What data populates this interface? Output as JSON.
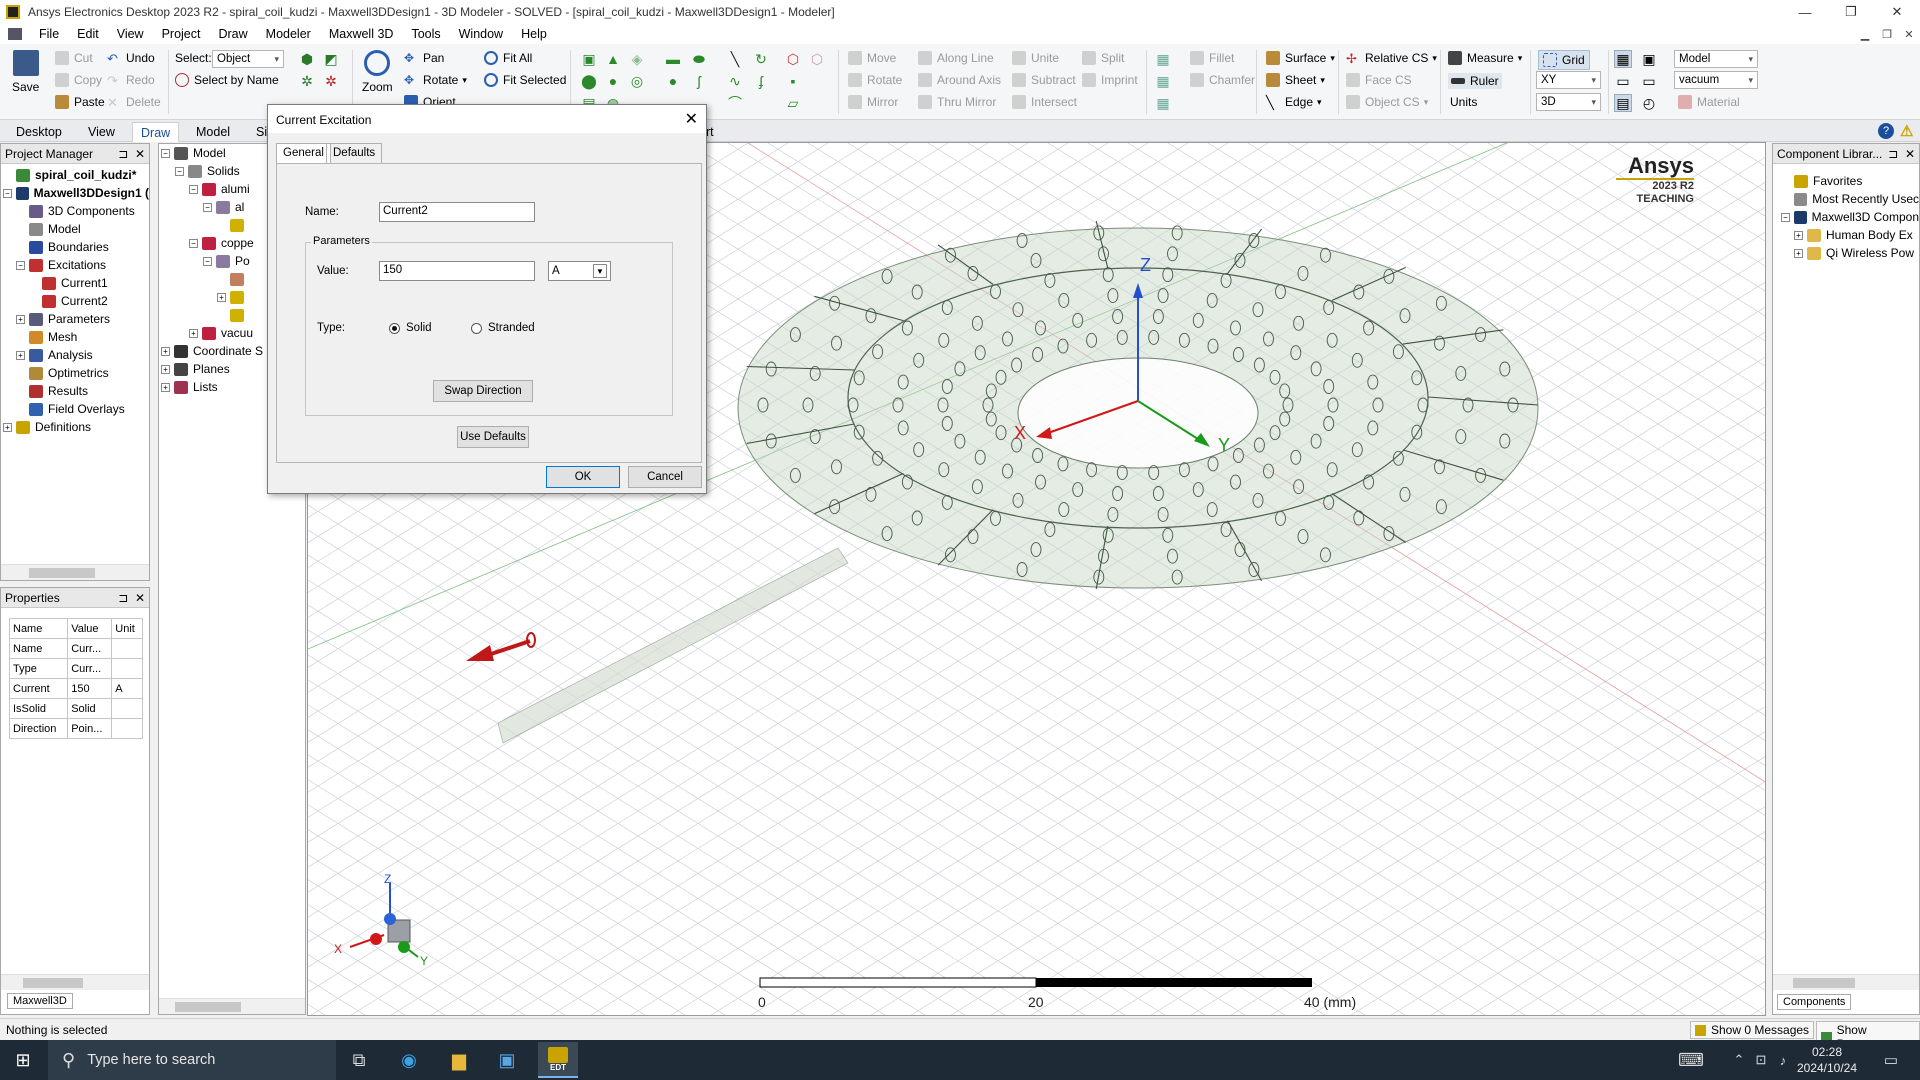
{
  "window": {
    "title": "Ansys Electronics Desktop 2023 R2 - spiral_coil_kudzi - Maxwell3DDesign1 - 3D Modeler - SOLVED - [spiral_coil_kudzi - Maxwell3DDesign1 - Modeler]",
    "minimize": "—",
    "restore": "❐",
    "close": "✕"
  },
  "menu": [
    "File",
    "Edit",
    "View",
    "Project",
    "Draw",
    "Modeler",
    "Maxwell 3D",
    "Tools",
    "Window",
    "Help"
  ],
  "ribbon": {
    "save": "Save",
    "cut": "Cut",
    "copy": "Copy",
    "paste": "Paste",
    "undo": "Undo",
    "redo": "Redo",
    "delete": "Delete",
    "select_label": "Select:",
    "select_value": "Object",
    "select_by_name": "Select by Name",
    "zoom": "Zoom",
    "pan": "Pan",
    "rotate": "Rotate",
    "orient": "Orient",
    "fit_all": "Fit All",
    "fit_selected": "Fit Selected",
    "move": "Move",
    "rotate2": "Rotate",
    "mirror": "Mirror",
    "along_line": "Along Line",
    "around_axis": "Around Axis",
    "thru_mirror": "Thru Mirror",
    "unite": "Unite",
    "subtract": "Subtract",
    "intersect": "Intersect",
    "split": "Split",
    "imprint": "Imprint",
    "fillet": "Fillet",
    "chamfer": "Chamfer",
    "surface": "Surface",
    "sheet": "Sheet",
    "edge": "Edge",
    "relative_cs": "Relative CS",
    "face_cs": "Face CS",
    "object_cs": "Object CS",
    "measure": "Measure",
    "ruler": "Ruler",
    "units": "Units",
    "grid": "Grid",
    "plane": "XY",
    "dim": "3D",
    "model": "Model",
    "material_value": "vacuum",
    "material": "Material"
  },
  "ribbon_tabs": [
    "Desktop",
    "View",
    "Draw",
    "Model",
    "Si"
  ],
  "ribbon_tab_extra": "rt",
  "project_manager": {
    "title": "Project Manager",
    "pin": "⊐",
    "close": "✕",
    "items": [
      {
        "label": "spiral_coil_kudzi*",
        "level": 0,
        "bold": true,
        "exp": ""
      },
      {
        "label": "Maxwell3DDesign1 (",
        "level": 0,
        "bold": true,
        "exp": "−"
      },
      {
        "label": "3D Components",
        "level": 1,
        "exp": ""
      },
      {
        "label": "Model",
        "level": 1,
        "exp": ""
      },
      {
        "label": "Boundaries",
        "level": 1,
        "exp": ""
      },
      {
        "label": "Excitations",
        "level": 1,
        "exp": "−"
      },
      {
        "label": "Current1",
        "level": 2,
        "exp": ""
      },
      {
        "label": "Current2",
        "level": 2,
        "exp": ""
      },
      {
        "label": "Parameters",
        "level": 1,
        "exp": "+"
      },
      {
        "label": "Mesh",
        "level": 1,
        "exp": ""
      },
      {
        "label": "Analysis",
        "level": 1,
        "exp": "+"
      },
      {
        "label": "Optimetrics",
        "level": 1,
        "exp": ""
      },
      {
        "label": "Results",
        "level": 1,
        "exp": ""
      },
      {
        "label": "Field Overlays",
        "level": 1,
        "exp": ""
      },
      {
        "label": "Definitions",
        "level": 0,
        "exp": "+"
      }
    ]
  },
  "properties": {
    "title": "Properties",
    "headers": [
      "Name",
      "Value",
      "Unit"
    ],
    "rows": [
      [
        "Name",
        "Curr...",
        ""
      ],
      [
        "Type",
        "Curr...",
        ""
      ],
      [
        "Current",
        "150",
        "A"
      ],
      [
        "IsSolid",
        "Solid",
        ""
      ],
      [
        "Direction",
        "Poin...",
        ""
      ]
    ],
    "tab": "Maxwell3D"
  },
  "model_tree": {
    "items": [
      {
        "label": "Model",
        "level": 0,
        "exp": "−"
      },
      {
        "label": "Solids",
        "level": 1,
        "exp": "−"
      },
      {
        "label": "alumi",
        "level": 2,
        "exp": "−"
      },
      {
        "label": "al",
        "level": 3,
        "exp": "−"
      },
      {
        "label": "",
        "level": 4,
        "exp": ""
      },
      {
        "label": "coppe",
        "level": 2,
        "exp": "−"
      },
      {
        "label": "Po",
        "level": 3,
        "exp": "−"
      },
      {
        "label": "",
        "level": 4,
        "exp": ""
      },
      {
        "label": "",
        "level": 4,
        "exp": "+"
      },
      {
        "label": "",
        "level": 4,
        "exp": ""
      },
      {
        "label": "vacuu",
        "level": 2,
        "exp": "+"
      },
      {
        "label": "Coordinate S",
        "level": 0,
        "exp": "+"
      },
      {
        "label": "Planes",
        "level": 0,
        "exp": "+"
      },
      {
        "label": "Lists",
        "level": 0,
        "exp": "+"
      }
    ]
  },
  "component_library": {
    "title": "Component Librar...",
    "tab": "Components",
    "items": [
      {
        "label": "Favorites",
        "level": 0,
        "exp": ""
      },
      {
        "label": "Most Recently Usec",
        "level": 0,
        "exp": ""
      },
      {
        "label": "Maxwell3D Compon",
        "level": 0,
        "exp": "−"
      },
      {
        "label": "Human Body Ex",
        "level": 1,
        "exp": "+"
      },
      {
        "label": "Qi Wireless Pow",
        "level": 1,
        "exp": "+"
      }
    ]
  },
  "viewport": {
    "brand": "Ansys",
    "version": "2023 R2",
    "license": "TEACHING",
    "axis_labels": {
      "z": "Z",
      "x": "X",
      "y": "Y"
    },
    "scale": {
      "ticks": [
        "0",
        "20",
        "40 (mm)"
      ]
    }
  },
  "dialog": {
    "title": "Current Excitation",
    "close": "✕",
    "tabs": [
      "General",
      "Defaults"
    ],
    "name_label": "Name:",
    "name_value": "Current2",
    "params_label": "Parameters",
    "value_label": "Value:",
    "value": "150",
    "unit": "A",
    "type_label": "Type:",
    "solid": "Solid",
    "stranded": "Stranded",
    "type_selected": "Solid",
    "swap": "Swap Direction",
    "use_defaults": "Use Defaults",
    "ok": "OK",
    "cancel": "Cancel"
  },
  "statusbar": {
    "text": "Nothing is selected",
    "messages": "Show 0 Messages",
    "progress": "Show Progress"
  },
  "taskbar": {
    "search": "Type here to search",
    "edt": "EDT",
    "time": "02:28",
    "date": "2024/10/24"
  },
  "colors": {
    "accent": "#1c4f9a",
    "coil": "#5c7a5c",
    "axis_x": "#d01818",
    "axis_y": "#1a9a1a",
    "axis_z": "#2450d0"
  }
}
